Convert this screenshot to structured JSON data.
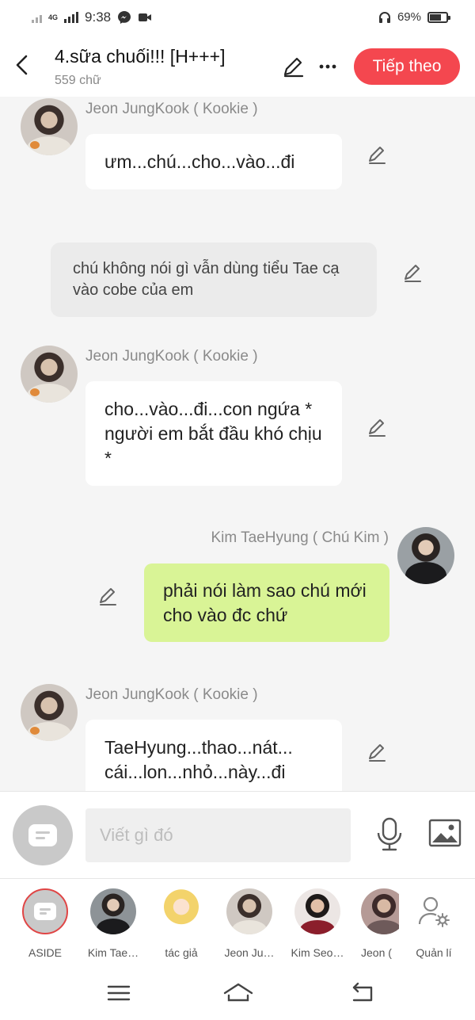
{
  "status_bar": {
    "network": "4G",
    "time": "9:38",
    "battery": "69%",
    "battery_level": 0.69,
    "icons": [
      "signal-icon",
      "messenger-icon",
      "video-icon",
      "headphones-icon",
      "battery-icon"
    ]
  },
  "header": {
    "title": "4.sữa chuối!!! [H+++]",
    "subtitle": "559 chữ",
    "next_label": "Tiếp theo",
    "next_color": "#f4474f"
  },
  "messages": [
    {
      "speaker": "Jeon JungKook ( Kookie )",
      "text": "ưm...chú...cho...vào...đi"
    },
    {
      "narration": "chú không nói gì vẫn dùng tiểu Tae cạ vào cobe của em"
    },
    {
      "speaker": "Jeon JungKook ( Kookie )",
      "text": "cho...vào...đi...con ngứa * người em bắt đầu khó chịu *"
    },
    {
      "speaker": "Kim TaeHyung ( Chú Kim )",
      "text": "phải nói làm sao chú mới cho vào đc chứ",
      "bubble_color": "#d9f496"
    },
    {
      "speaker": "Jeon JungKook ( Kookie )",
      "text": "TaeHyung...thao...nát... cái...lon...nhỏ...này...đi"
    }
  ],
  "input": {
    "placeholder": "Viết gì đó"
  },
  "characters": [
    {
      "label": "ASIDE"
    },
    {
      "label": "Kim Tae…"
    },
    {
      "label": "tác giả"
    },
    {
      "label": "Jeon Ju…"
    },
    {
      "label": "Kim Seo…"
    },
    {
      "label": "Jeon ("
    },
    {
      "label": "Quản lí"
    }
  ],
  "accent_color": "#e04545"
}
